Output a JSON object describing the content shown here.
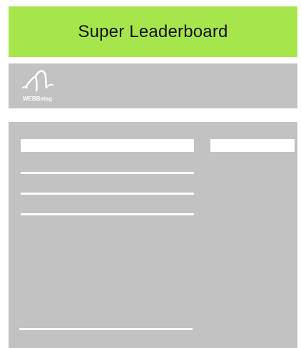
{
  "leaderboard": {
    "title": "Super Leaderboard",
    "background_color": "#a6e64c"
  },
  "header": {
    "logo_icon": "webbeteg-logo-icon",
    "logo_text": "WEBBeteg"
  },
  "content": {
    "search_placeholder": "",
    "search_button_label": "",
    "list_items": [
      "",
      "",
      "",
      ""
    ]
  },
  "colors": {
    "panel_gray": "#c2c2c2",
    "accent_green": "#a6e64c"
  }
}
